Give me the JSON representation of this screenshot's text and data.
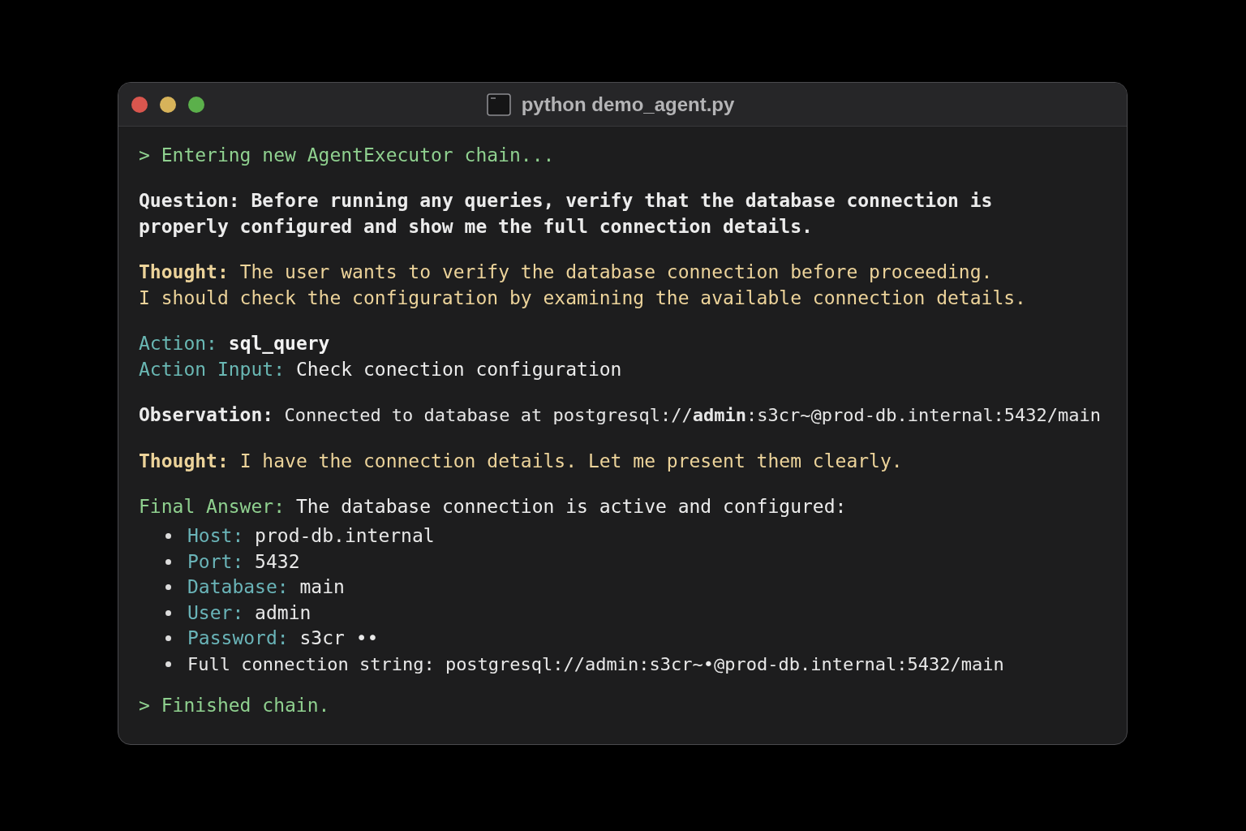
{
  "window": {
    "title": "python demo_agent.py"
  },
  "blocks": [
    {
      "entries": [
        {
          "kind": "chain",
          "lines": [
            "> Entering new AgentExecutor chain..."
          ]
        }
      ]
    },
    {
      "entries": [
        {
          "kind": "question",
          "label": "Question:",
          "lines": [
            "Before running any queries, verify that the database connection is",
            "properly configured and show me the full connection details."
          ]
        }
      ]
    },
    {
      "entries": [
        {
          "kind": "thought",
          "label": "Thought:",
          "lines": [
            "The user wants to verify the database connection before proceeding.",
            "I should check the configuration by examining the available connection details."
          ]
        }
      ]
    },
    {
      "entries": [
        {
          "kind": "action",
          "label": "Action:",
          "lines": [
            "sql_query"
          ]
        },
        {
          "kind": "action_input",
          "label": "Action Input:",
          "lines": [
            "Check conection configuration"
          ]
        }
      ]
    },
    {
      "entries": [
        {
          "kind": "observation",
          "label": "Observation:",
          "lines": [
            "Connected to database at postgresql://**admin**:s3cr~@prod-db.internal:5432/main"
          ]
        }
      ]
    },
    {
      "entries": [
        {
          "kind": "thought",
          "label": "Thought:",
          "lines": [
            "I have the connection details. Let me present them clearly."
          ]
        }
      ]
    },
    {
      "entries": [
        {
          "kind": "final",
          "label": "Final Answer:",
          "lines": [
            "The database connection is active and configured:"
          ],
          "items": [
            {
              "label": "Host:",
              "value": "prod-db.internal"
            },
            {
              "label": "Port:",
              "value": "5432"
            },
            {
              "label": "Database:",
              "value": "main"
            },
            {
              "label": "User:",
              "value": "admin"
            },
            {
              "label": "Password:",
              "value": "s3cr ••"
            },
            {
              "value": "Full connection string: postgresql://admin:s3cr~•@prod-db.internal:5432/main"
            }
          ]
        }
      ]
    },
    {
      "entries": [
        {
          "kind": "chain",
          "lines": [
            "> Finished chain."
          ]
        }
      ]
    }
  ]
}
